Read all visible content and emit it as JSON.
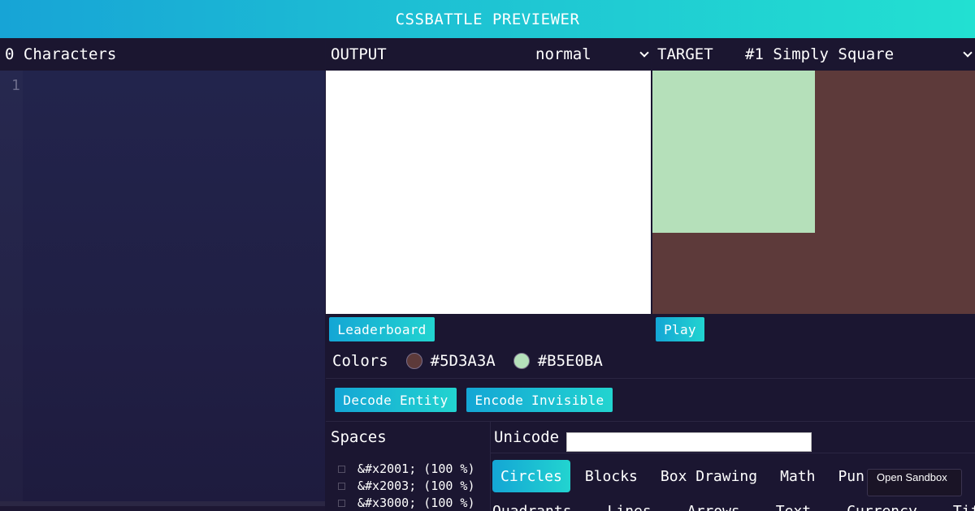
{
  "app": {
    "title": "CSSBATTLE PREVIEWER"
  },
  "editor": {
    "char_count_label": "0 Characters",
    "line_number": "1"
  },
  "output": {
    "label": "OUTPUT",
    "mode_value": "normal"
  },
  "target": {
    "label": "TARGET",
    "selected": "#1 Simply Square",
    "bg_color": "#5D3A3A",
    "square_color": "#B5E0BA"
  },
  "buttons": {
    "leaderboard": "Leaderboard",
    "play": "Play",
    "decode": "Decode Entity",
    "encode": "Encode Invisible"
  },
  "colors": {
    "label": "Colors",
    "items": [
      {
        "hex": "#5D3A3A"
      },
      {
        "hex": "#B5E0BA"
      }
    ]
  },
  "spaces": {
    "label": "Spaces",
    "items": [
      "&#x2001; (100 %)",
      "&#x2003; (100 %)",
      "&#x3000; (100 %)"
    ]
  },
  "unicode": {
    "label": "Unicode",
    "value": ""
  },
  "categories": {
    "row1": [
      "Circles",
      "Blocks",
      "Box Drawing",
      "Math",
      "Pun"
    ],
    "active": "Circles",
    "row2": [
      "Quadrants",
      "Lines",
      "Arrows",
      "Text",
      "Currency",
      "Tifinagh"
    ]
  },
  "sandbox": {
    "label": "Open Sandbox"
  }
}
